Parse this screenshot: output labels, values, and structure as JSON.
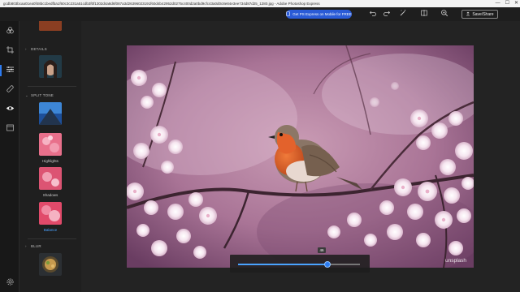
{
  "titlebar": {
    "title": "gcdb803bcaa01ea0f48bc1bedfba1f60c3c231a51cdb3f0f1302d4a8d6f087a3d26396023191f60d4b42952d0275c400d2a0bd9cfc43a0d0c8e84e3ee734d87d25_1280.jpg - Adobe Photoshop Express",
    "controls": [
      "—",
      "☐",
      "✕"
    ]
  },
  "toolbar": {
    "promo_label": "Get PS Express on Mobile for FREE",
    "save_share_label": "Save/Share"
  },
  "panel": {
    "details_title": "DETAILS",
    "split_tone_title": "SPLIT TONE",
    "highlights_label": "Highlights",
    "shadows_label": "Shadows",
    "balance_label": "Balance",
    "blur_title": "BLUR"
  },
  "slider": {
    "value": "46",
    "fraction": 0.73
  },
  "watermark": "unsplash",
  "colors": {
    "accent": "#2d7bf0",
    "promo": "#2a5bd7"
  }
}
